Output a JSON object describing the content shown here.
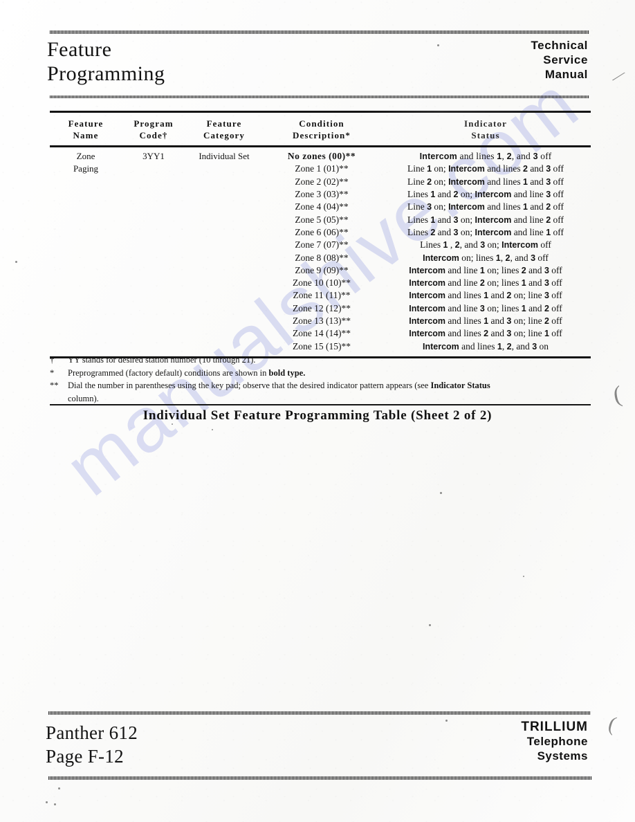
{
  "header": {
    "title_line1": "Feature",
    "title_line2": "Programming",
    "manual_line1": "Technical",
    "manual_line2": "Service",
    "manual_line3": "Manual"
  },
  "watermark": {
    "text": "manualshive.com"
  },
  "table": {
    "columns": [
      {
        "line1": "Feature",
        "line2": "Name"
      },
      {
        "line1": "Program",
        "line2": "Code†"
      },
      {
        "line1": "Feature",
        "line2": "Category"
      },
      {
        "line1": "Condition",
        "line2": "Description*"
      },
      {
        "line1": "Indicator",
        "line2": "Status"
      }
    ],
    "feature_name_line1": "Zone",
    "feature_name_line2": "Paging",
    "program_code": "3YY1",
    "feature_category": "Individual Set",
    "rows": [
      {
        "condition": "No zones (00)**",
        "default": true,
        "indicator_html": "<b>Intercom</b> and lines <b>1</b>, <b>2</b>, and <b>3</b> off",
        "indicator_text": "Intercom and lines 1, 2, and 3 off"
      },
      {
        "condition": "Zone 1 (01)**",
        "default": false,
        "indicator_html": "Line <b>1</b> on; <b>Intercom</b> and lines <b>2</b> and <b>3</b> off",
        "indicator_text": "Line 1 on; Intercom and lines 2 and 3 off"
      },
      {
        "condition": "Zone 2 (02)**",
        "default": false,
        "indicator_html": "Line <b>2</b> on; <b>Intercom</b> and lines <b>1</b> and <b>3</b> off",
        "indicator_text": "Line 2 on; Intercom and lines 1 and 3 off"
      },
      {
        "condition": "Zone 3 (03)**",
        "default": false,
        "indicator_html": "Lines <b>1</b> and <b>2</b> on; <b>Intercom</b> and line <b>3</b> off",
        "indicator_text": "Lines 1 and 2 on; Intercom and line 3 off"
      },
      {
        "condition": "Zone 4 (04)**",
        "default": false,
        "indicator_html": "Line <b>3</b> on; <b>Intercom</b> and lines <b>1</b> and <b>2</b> off",
        "indicator_text": "Line 3 on; Intercom and lines 1 and 2 off"
      },
      {
        "condition": "Zone 5 (05)**",
        "default": false,
        "indicator_html": "Lines <b>1</b> and <b>3</b> on; <b>Intercom</b> and line <b>2</b> off",
        "indicator_text": "Lines 1 and 3 on; Intercom and line 2 off"
      },
      {
        "condition": "Zone 6 (06)**",
        "default": false,
        "indicator_html": "Lines <b>2</b> and <b>3</b> on; <b>Intercom</b> and line <b>1</b> off",
        "indicator_text": "Lines 2 and 3 on; Intercom and line 1 off"
      },
      {
        "condition": "Zone 7 (07)**",
        "default": false,
        "indicator_html": "Lines <b>1</b> , <b>2</b>, and <b>3</b> on; <b>Intercom</b> off",
        "indicator_text": "Lines 1 , 2, and 3 on; Intercom off"
      },
      {
        "condition": "Zone 8 (08)**",
        "default": false,
        "indicator_html": "<b>Intercom</b> on; lines <b>1</b>, <b>2</b>, and <b>3</b> off",
        "indicator_text": "Intercom on; lines 1, 2, and 3 off"
      },
      {
        "condition": "Zone 9 (09)**",
        "default": false,
        "indicator_html": "<b>Intercom</b> and line <b>1</b> on; lines <b>2</b> and <b>3</b> off",
        "indicator_text": "Intercom and line 1 on; lines 2 and 3 off"
      },
      {
        "condition": "Zone 10 (10)**",
        "default": false,
        "indicator_html": "<b>Intercom</b> and line <b>2</b> on; lines <b>1</b> and <b>3</b> off",
        "indicator_text": "Intercom and line 2 on; lines 1 and 3 off"
      },
      {
        "condition": "Zone 11 (11)**",
        "default": false,
        "indicator_html": "<b>Intercom</b> and lines <b>1</b> and <b>2</b> on; line <b>3</b> off",
        "indicator_text": "Intercom and lines 1 and 2 on; line 3 off"
      },
      {
        "condition": "Zone 12 (12)**",
        "default": false,
        "indicator_html": "<b>Intercom</b> and line <b>3</b> on; lines <b>1</b> and <b>2</b> off",
        "indicator_text": "Intercom and line 3 on; lines 1 and 2 off"
      },
      {
        "condition": "Zone 13 (13)**",
        "default": false,
        "indicator_html": "<b>Intercom</b> and lines <b>1</b> and <b>3</b> on; line <b>2</b> off",
        "indicator_text": "Intercom and lines 1 and 3 on; line 2 off"
      },
      {
        "condition": "Zone 14 (14)**",
        "default": false,
        "indicator_html": "<b>Intercom</b> and lines <b>2</b> and <b>3</b> on; line <b>1</b> off",
        "indicator_text": "Intercom and lines 2 and 3 on; line 1 off"
      },
      {
        "condition": "Zone 15 (15)**",
        "default": false,
        "indicator_html": "<b>Intercom</b> and lines <b>1</b>, <b>2</b>, and <b>3</b> on",
        "indicator_text": "Intercom and lines 1, 2, and 3 on"
      }
    ]
  },
  "footnotes": [
    {
      "mark": "†",
      "html": "YY stands for desired station number (10 through 21).",
      "text": "YY stands for desired station number (10 through 21).",
      "continuation": ""
    },
    {
      "mark": "*",
      "html": "Preprogrammed (factory default) conditions are shown in <b>bold type.</b>",
      "text": "Preprogrammed (factory default) conditions are shown in bold type.",
      "continuation": ""
    },
    {
      "mark": "**",
      "html": "Dial the number in parentheses using the key pad; observe that the desired indicator pattern appears (see <b>Indicator Status</b>",
      "text": "Dial the number in parentheses using the key pad; observe that the desired indicator pattern appears (see Indicator Status",
      "continuation": "column)."
    }
  ],
  "caption": "Individual Set Feature Programming Table (Sheet 2 of 2)",
  "footer": {
    "product": "Panther 612",
    "page": "Page F-12",
    "company_brand": "TRILLIUM",
    "company_line2": "Telephone",
    "company_line3": "Systems"
  }
}
